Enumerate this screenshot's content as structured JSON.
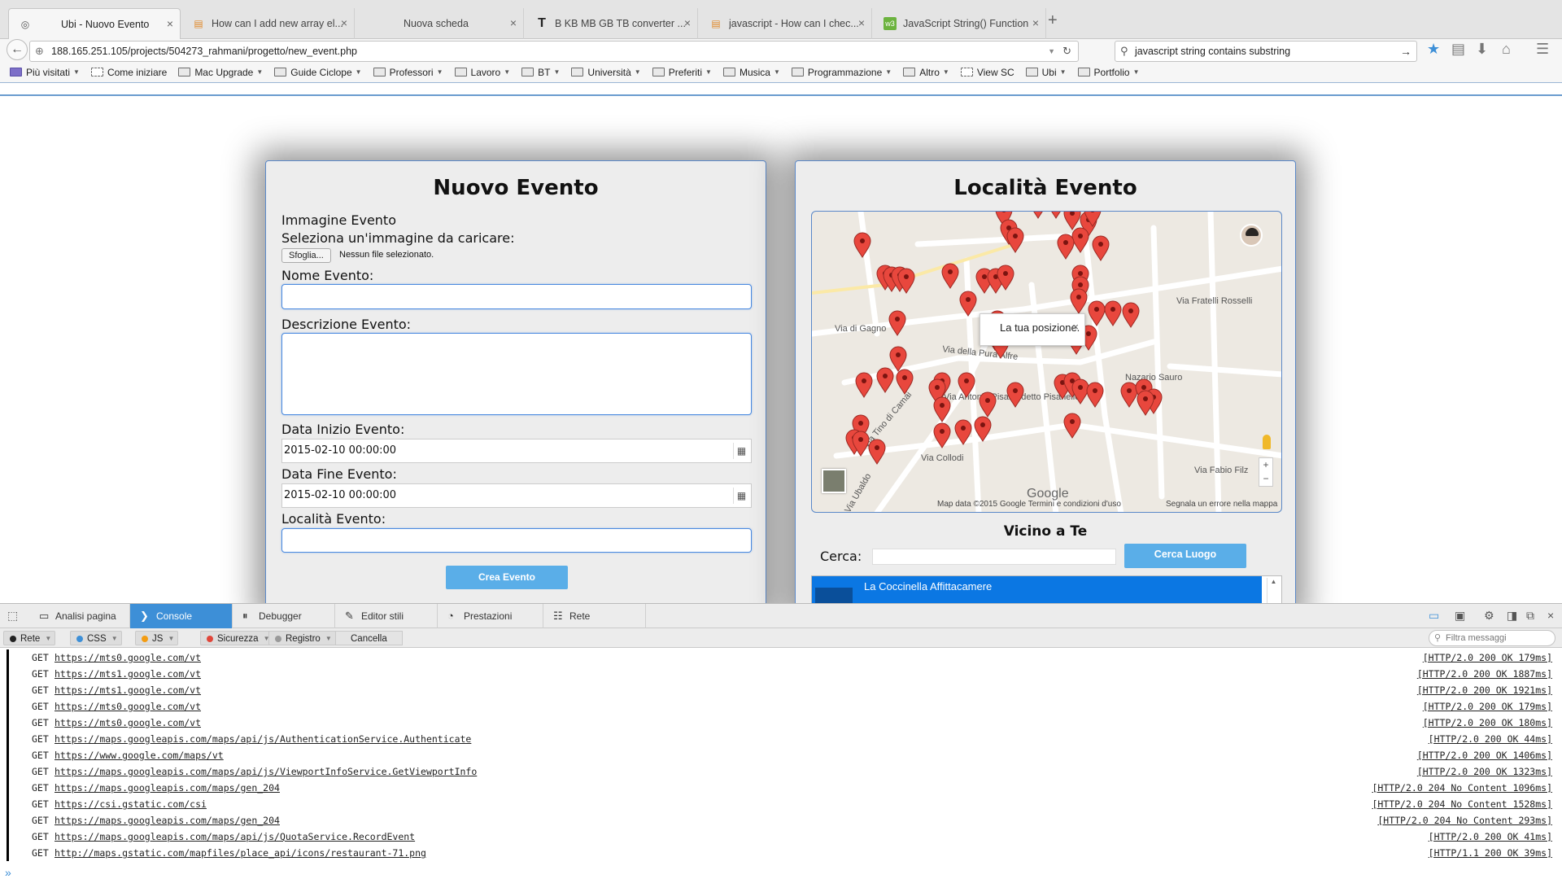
{
  "browser": {
    "tabs": [
      {
        "title": "Ubi - Nuovo Evento",
        "icon": "location-icon",
        "active": true
      },
      {
        "title": "How can I add new array el...",
        "icon": "stackoverflow-icon"
      },
      {
        "title": "Nuova scheda",
        "icon": "blank-icon"
      },
      {
        "title": "B KB MB GB TB converter ...",
        "icon": "t-icon"
      },
      {
        "title": "javascript - How can I chec...",
        "icon": "stackoverflow-icon"
      },
      {
        "title": "JavaScript String() Function",
        "icon": "w3-icon"
      }
    ],
    "url": "188.165.251.105/projects/504273_rahmani/progetto/new_event.php",
    "search_value": "javascript string contains substring",
    "bookmarks": [
      {
        "label": "Più visitati",
        "type": "smart",
        "caret": true
      },
      {
        "label": "Come iniziare",
        "type": "page",
        "caret": false
      },
      {
        "label": "Mac Upgrade",
        "type": "folder",
        "caret": true
      },
      {
        "label": "Guide Ciclope",
        "type": "folder",
        "caret": true
      },
      {
        "label": "Professori",
        "type": "folder",
        "caret": true
      },
      {
        "label": "Lavoro",
        "type": "folder",
        "caret": true
      },
      {
        "label": "BT",
        "type": "folder",
        "caret": true
      },
      {
        "label": "Università",
        "type": "folder",
        "caret": true
      },
      {
        "label": "Preferiti",
        "type": "folder",
        "caret": true
      },
      {
        "label": "Musica",
        "type": "folder",
        "caret": true
      },
      {
        "label": "Programmazione",
        "type": "folder",
        "caret": true
      },
      {
        "label": "Altro",
        "type": "folder",
        "caret": true
      },
      {
        "label": "View SC",
        "type": "page",
        "caret": false
      },
      {
        "label": "Ubi",
        "type": "folder",
        "caret": true
      },
      {
        "label": "Portfolio",
        "type": "folder",
        "caret": true
      }
    ]
  },
  "form": {
    "title": "Nuovo Evento",
    "image_label": "Immagine Evento",
    "image_prompt": "Seleziona un'immagine da caricare:",
    "browse_label": "Sfoglia...",
    "no_file": "Nessun file selezionato.",
    "name_label": "Nome Evento:",
    "name_value": "",
    "desc_label": "Descrizione Evento:",
    "desc_value": "",
    "start_label": "Data Inizio Evento:",
    "start_value": "2015-02-10 00:00:00",
    "end_label": "Data Fine Evento:",
    "end_value": "2015-02-10 00:00:00",
    "place_label": "Località Evento:",
    "place_value": "",
    "submit_label": "Crea Evento"
  },
  "location": {
    "title": "Località Evento",
    "popup_text": "La tua posizione.",
    "streets": [
      "Via di Gagno",
      "Via della Pura Alfre",
      "Via Tino di Camai",
      "Via Antonio Pisano detto Pisanello",
      "Via Collodi",
      "Via Fratelli Rosselli",
      "Nazario Sauro",
      "Via Fabio Filz",
      "Via Ubaldo"
    ],
    "map_credit": "Map data ©2015 Google   Termini e condizioni d'uso",
    "map_report": "Segnala un errore nella mappa",
    "google_label": "Google",
    "nearby_title": "Vicino a Te",
    "search_label": "Cerca:",
    "search_value": "",
    "search_button": "Cerca Luogo",
    "results": [
      {
        "name": "La Coccinella Affittacamere"
      }
    ]
  },
  "devtools": {
    "tabs": [
      "Analisi pagina",
      "Console",
      "Debugger",
      "Editor stili",
      "Prestazioni",
      "Rete"
    ],
    "active_tab": "Console",
    "filters": [
      {
        "label": "Rete",
        "color": "#222222"
      },
      {
        "label": "CSS",
        "color": "#3d8fd7"
      },
      {
        "label": "JS",
        "color": "#f39c12"
      },
      {
        "label": "Sicurezza",
        "color": "#e0463a"
      },
      {
        "label": "Registro",
        "color": "#9a9a9a"
      }
    ],
    "clear_label": "Cancella",
    "filter_placeholder": "Filtra messaggi",
    "log": [
      {
        "method": "GET",
        "url": "https://mts0.google.com/vt",
        "status": "[HTTP/2.0 200 OK 179ms]"
      },
      {
        "method": "GET",
        "url": "https://mts1.google.com/vt",
        "status": "[HTTP/2.0 200 OK 1887ms]"
      },
      {
        "method": "GET",
        "url": "https://mts1.google.com/vt",
        "status": "[HTTP/2.0 200 OK 1921ms]"
      },
      {
        "method": "GET",
        "url": "https://mts0.google.com/vt",
        "status": "[HTTP/2.0 200 OK 179ms]"
      },
      {
        "method": "GET",
        "url": "https://mts0.google.com/vt",
        "status": "[HTTP/2.0 200 OK 180ms]"
      },
      {
        "method": "GET",
        "url": "https://maps.googleapis.com/maps/api/js/AuthenticationService.Authenticate",
        "status": "[HTTP/2.0 200 OK 44ms]"
      },
      {
        "method": "GET",
        "url": "https://www.google.com/maps/vt",
        "status": "[HTTP/2.0 200 OK 1406ms]"
      },
      {
        "method": "GET",
        "url": "https://maps.googleapis.com/maps/api/js/ViewportInfoService.GetViewportInfo",
        "status": "[HTTP/2.0 200 OK 1323ms]"
      },
      {
        "method": "GET",
        "url": "https://maps.googleapis.com/maps/gen_204",
        "status": "[HTTP/2.0 204 No Content 1096ms]"
      },
      {
        "method": "GET",
        "url": "https://csi.gstatic.com/csi",
        "status": "[HTTP/2.0 204 No Content 1528ms]"
      },
      {
        "method": "GET",
        "url": "https://maps.googleapis.com/maps/gen_204",
        "status": "[HTTP/2.0 204 No Content 293ms]"
      },
      {
        "method": "GET",
        "url": "https://maps.googleapis.com/maps/api/js/QuotaService.RecordEvent",
        "status": "[HTTP/2.0 200 OK 41ms]"
      },
      {
        "method": "GET",
        "url": "http://maps.gstatic.com/mapfiles/place_api/icons/restaurant-71.png",
        "status": "[HTTP/1.1 200 OK 39ms]"
      }
    ]
  }
}
